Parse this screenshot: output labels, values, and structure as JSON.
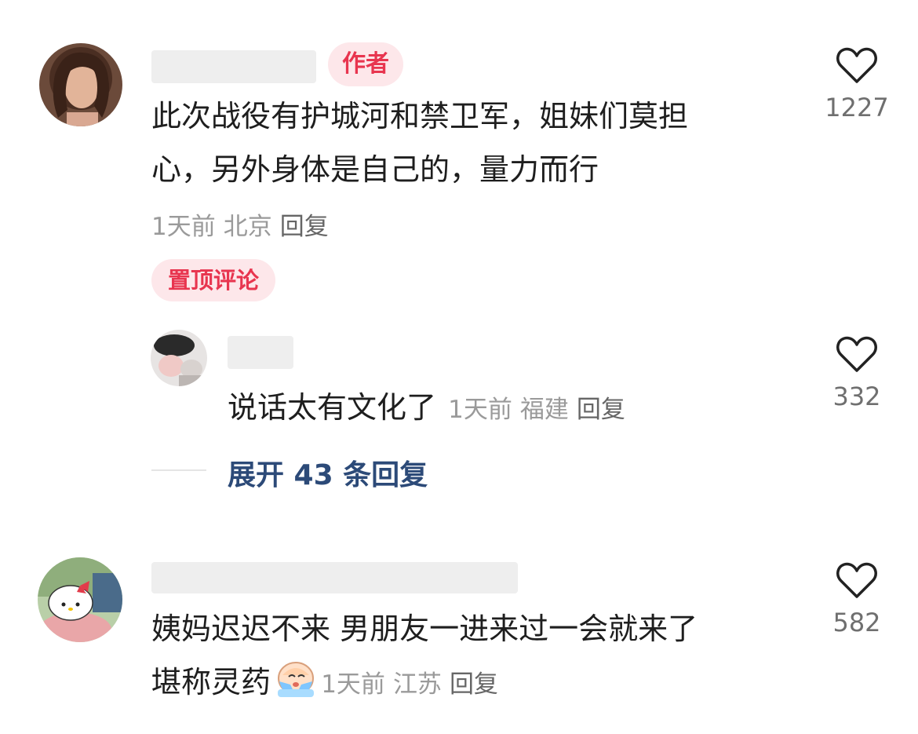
{
  "comments": [
    {
      "badge": "作者",
      "text_line1": "此次战役有护城河和禁卫军，姐妹们莫担",
      "text_line2": "心，另外身体是自己的，量力而行",
      "time": "1天前",
      "location": "北京",
      "reply_label": "回复",
      "likes": "1227",
      "pinned_label": "置顶评论",
      "avatar_icon": "user-avatar-curly-hair-woman",
      "replies": [
        {
          "text": "说话太有文化了",
          "time": "1天前",
          "location": "福建",
          "reply_label": "回复",
          "likes": "332",
          "avatar_icon": "user-avatar-photo"
        }
      ],
      "expand_label": "展开 43 条回复"
    },
    {
      "text_line1": "姨妈迟迟不来 男朋友一进来过一会就来了",
      "text_line2": "堪称灵药",
      "emoji_icon": "crying-face-emoji",
      "time": "1天前",
      "location": "江苏",
      "reply_label": "回复",
      "likes": "582",
      "avatar_icon": "user-avatar-hello-kitty"
    }
  ],
  "colors": {
    "accent_red": "#e8354f",
    "badge_bg": "#fde7ea",
    "expand_link": "#2c4a78"
  }
}
